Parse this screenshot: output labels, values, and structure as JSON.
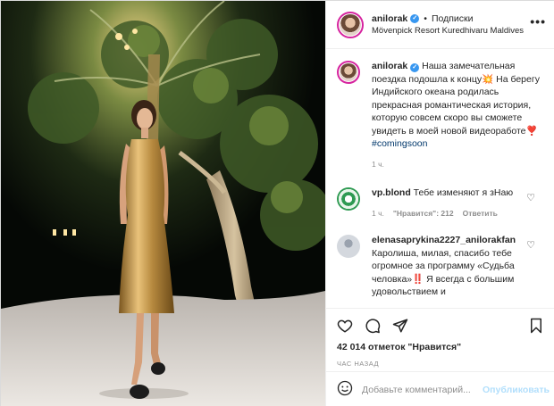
{
  "post": {
    "username": "anilorak",
    "follow_separator": "•",
    "follow_label": "Подписки",
    "location": "Mövenpick Resort Kuredhivaru Maldives",
    "more_label": "•••"
  },
  "caption": {
    "username": "anilorak",
    "text": "Наша замечательная поездка подошла к концу💥 На берегу Индийского океана родилась прекрасная романтическая история, которую совсем скоро вы сможете увидеть в моей новой видеоработе❣️",
    "hashtag": "#comingsoon",
    "time": "1 ч."
  },
  "comments": [
    {
      "username": "vp.blond",
      "text": "Тебе изменяют я зНаю",
      "time": "1 ч.",
      "likes": "\"Нравится\": 212",
      "reply": "Ответить"
    },
    {
      "username": "elenasaprykina2227_anilorakfan",
      "text": "Каролиша, милая, спасибо тебе огромное за программу «Судьба человка»‼️ Я всегда с большим удовольствием и"
    }
  ],
  "stats": {
    "likes": "42 014 отметок \"Нравится\"",
    "posted": "час назад"
  },
  "add_comment": {
    "placeholder": "Добавьте комментарий...",
    "post_label": "Опубликовать"
  },
  "icons": [
    "heart-icon",
    "comment-icon",
    "share-icon",
    "bookmark-icon",
    "emoji-icon",
    "verified-badge-icon"
  ],
  "colors": {
    "verified": "#3897f0",
    "story_ring": "#d6249f",
    "link": "#00376b",
    "post_button": "#b2dffc"
  }
}
